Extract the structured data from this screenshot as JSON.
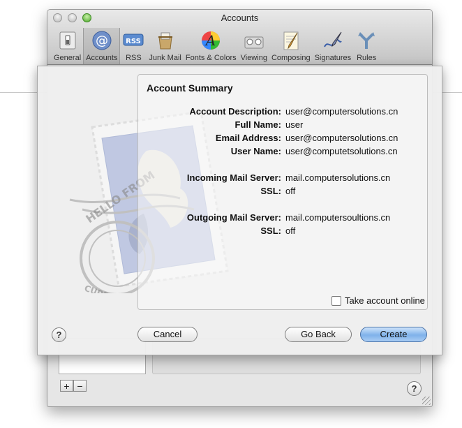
{
  "window": {
    "title": "Accounts"
  },
  "toolbar": {
    "items": [
      {
        "label": "General",
        "icon": "general-switch-icon"
      },
      {
        "label": "Accounts",
        "icon": "at-sign-icon",
        "selected": true
      },
      {
        "label": "RSS",
        "icon": "rss-icon"
      },
      {
        "label": "Junk Mail",
        "icon": "junk-mail-icon"
      },
      {
        "label": "Fonts & Colors",
        "icon": "fonts-colors-icon"
      },
      {
        "label": "Viewing",
        "icon": "viewing-icon"
      },
      {
        "label": "Composing",
        "icon": "composing-icon"
      },
      {
        "label": "Signatures",
        "icon": "signatures-icon"
      },
      {
        "label": "Rules",
        "icon": "rules-icon"
      }
    ]
  },
  "sheet": {
    "summary_title": "Account Summary",
    "rows": [
      {
        "label": "Account Description:",
        "value": "user@computersolutions.cn"
      },
      {
        "label": "Full Name:",
        "value": "user"
      },
      {
        "label": "Email Address:",
        "value": "user@computersolutions.cn"
      },
      {
        "label": "User Name:",
        "value": "user@computetsolutions.cn"
      },
      {
        "label": "Incoming Mail Server:",
        "value": "mail.computersolutions.cn"
      },
      {
        "label": "SSL:",
        "value": "off"
      },
      {
        "label": "Outgoing Mail Server:",
        "value": "mail.computersoultions.cn"
      },
      {
        "label": "SSL:",
        "value": "off"
      }
    ],
    "take_online_label": "Take account online",
    "take_online_checked": false,
    "stamp_text_top": "HELLO FROM",
    "stamp_text_bottom": "CUPERTINO, CA",
    "buttons": {
      "cancel": "Cancel",
      "go_back": "Go Back",
      "create": "Create"
    }
  },
  "pane": {
    "add_label": "+",
    "remove_label": "−"
  },
  "help_label": "?",
  "colors": {
    "default_button": "#7fb2ea",
    "accent_green": "#4aa629"
  }
}
